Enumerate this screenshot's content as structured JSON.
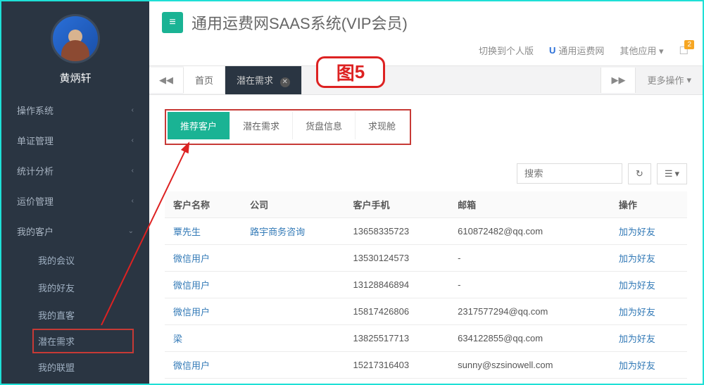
{
  "profile": {
    "username": "黄炳轩"
  },
  "sidebar": {
    "items": [
      {
        "label": "操作系统"
      },
      {
        "label": "单证管理"
      },
      {
        "label": "统计分析"
      },
      {
        "label": "运价管理"
      },
      {
        "label": "我的客户"
      }
    ],
    "sub": [
      {
        "label": "我的会议"
      },
      {
        "label": "我的好友"
      },
      {
        "label": "我的直客"
      },
      {
        "label": "潜在需求"
      },
      {
        "label": "我的联盟"
      }
    ]
  },
  "header": {
    "title": "通用运费网SAAS系统(VIP会员)",
    "switch_personal": "切换到个人版",
    "freight_net": "通用运费网",
    "other_apps": "其他应用",
    "notif_count": "2"
  },
  "tabs": {
    "home": "首页",
    "active": "潜在需求",
    "more_ops": "更多操作"
  },
  "pills": {
    "p0": "推荐客户",
    "p1": "潜在需求",
    "p2": "货盘信息",
    "p3": "求现舱"
  },
  "search": {
    "placeholder": "搜索"
  },
  "table": {
    "headers": {
      "name": "客户名称",
      "company": "公司",
      "phone": "客户手机",
      "email": "邮箱",
      "action": "操作"
    },
    "action_label": "加为好友",
    "rows": [
      {
        "name": "覃先生",
        "company": "路宇商务咨询",
        "phone": "13658335723",
        "email": "610872482@qq.com"
      },
      {
        "name": "微信用户",
        "company": "",
        "phone": "13530124573",
        "email": "-"
      },
      {
        "name": "微信用户",
        "company": "",
        "phone": "13128846894",
        "email": "-"
      },
      {
        "name": "微信用户",
        "company": "",
        "phone": "15817426806",
        "email": "2317577294@qq.com"
      },
      {
        "name": "梁",
        "company": "",
        "phone": "13825517713",
        "email": "634122855@qq.com"
      },
      {
        "name": "微信用户",
        "company": "",
        "phone": "15217316403",
        "email": "sunny@szsinowell.com"
      }
    ]
  },
  "annotation": {
    "prefix": "图",
    "num": "5"
  }
}
